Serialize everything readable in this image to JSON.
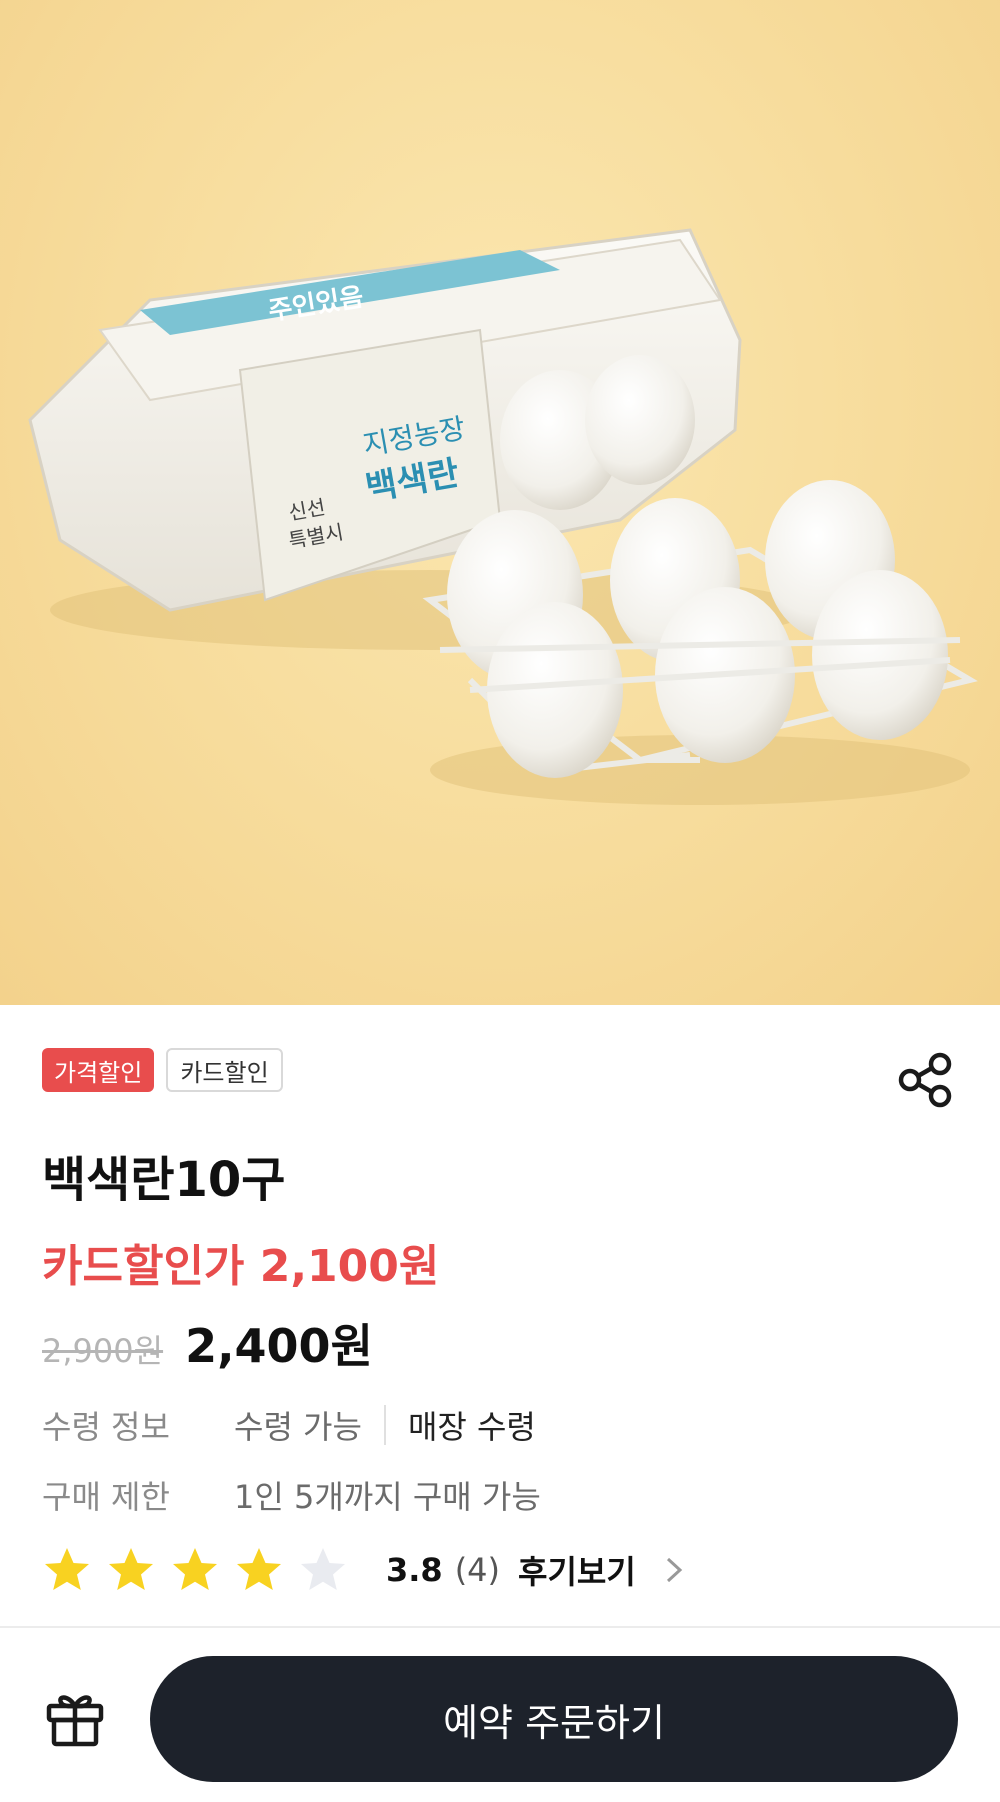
{
  "product": {
    "badges": [
      "가격할인",
      "카드할인"
    ],
    "name": "백색란10구",
    "card_price_text": "카드할인가 2,100원",
    "original_price": "2,900원",
    "sale_price": "2,400원",
    "image_label": {
      "carton_text_1": "지정농장",
      "carton_text_2": "백색란",
      "brand_text_1": "신선",
      "brand_text_2": "특별시",
      "band_text": "주인있음"
    }
  },
  "info": {
    "pickup_label": "수령 정보",
    "pickup_value_1": "수령 가능",
    "pickup_value_2": "매장 수령",
    "limit_label": "구매 제한",
    "limit_value": "1인 5개까지 구매 가능"
  },
  "rating": {
    "score": "3.8",
    "count": "(4)",
    "review_link": "후기보기",
    "filled_stars": 4,
    "total_stars": 5
  },
  "bottom": {
    "order_button": "예약 주문하기"
  },
  "colors": {
    "accent_red": "#e84d4d",
    "star_yellow": "#f8d221",
    "button_dark": "#1d222b"
  },
  "icons": {
    "share": "share-icon",
    "gift": "gift-icon",
    "chevron": "chevron-right-icon",
    "star": "star-icon"
  }
}
